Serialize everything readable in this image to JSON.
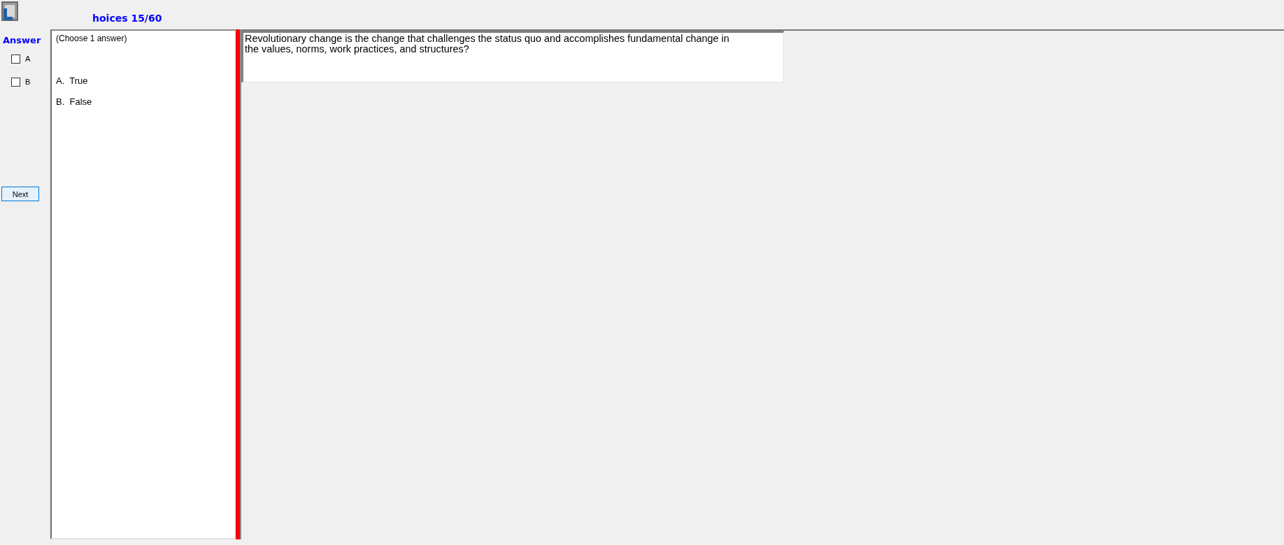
{
  "window": {
    "title": "hoices 15/60"
  },
  "answer_panel": {
    "label": "Answer",
    "choices": [
      {
        "label": "A",
        "checked": false
      },
      {
        "label": "B",
        "checked": false
      }
    ],
    "next_button": "Next"
  },
  "options_panel": {
    "instruction": "(Choose 1 answer)",
    "options": [
      {
        "letter": "A.",
        "text": "True"
      },
      {
        "letter": "B.",
        "text": "False"
      }
    ]
  },
  "question": {
    "text": "Revolutionary change is the change that challenges the status quo and accomplishes fundamental change in the values, norms, work practices, and structures?"
  }
}
